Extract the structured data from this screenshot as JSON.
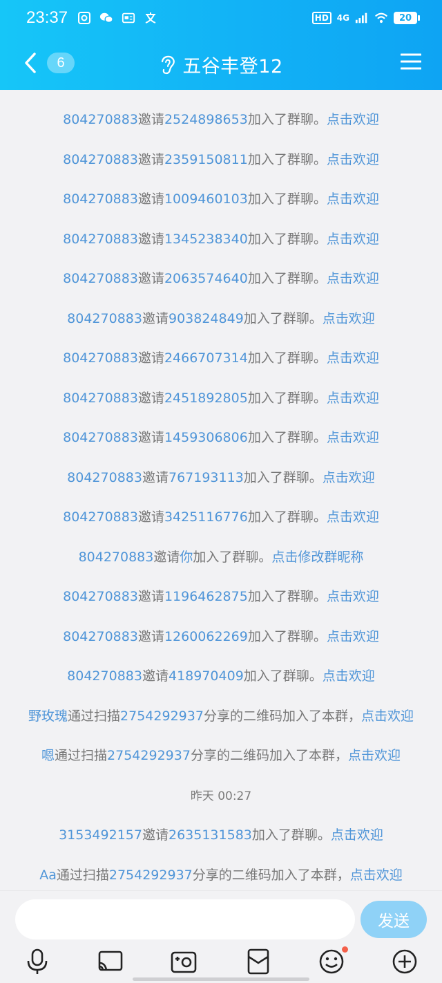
{
  "status_bar": {
    "time": "23:37",
    "hd": "HD",
    "network": "4G",
    "battery": "20"
  },
  "nav": {
    "unread_count": "6",
    "title": "五谷丰登12"
  },
  "messages": [
    {
      "user": "804270883",
      "verb": "邀请",
      "target": "2524898653",
      "tail": "加入了群聊。",
      "link": "点击欢迎"
    },
    {
      "user": "804270883",
      "verb": "邀请",
      "target": "2359150811",
      "tail": "加入了群聊。",
      "link": "点击欢迎"
    },
    {
      "user": "804270883",
      "verb": "邀请",
      "target": "1009460103",
      "tail": "加入了群聊。",
      "link": "点击欢迎"
    },
    {
      "user": "804270883",
      "verb": "邀请",
      "target": "1345238340",
      "tail": "加入了群聊。",
      "link": "点击欢迎"
    },
    {
      "user": "804270883",
      "verb": "邀请",
      "target": "2063574640",
      "tail": "加入了群聊。",
      "link": "点击欢迎"
    },
    {
      "user": "804270883",
      "verb": "邀请",
      "target": "903824849",
      "tail": "加入了群聊。",
      "link": "点击欢迎"
    },
    {
      "user": "804270883",
      "verb": "邀请",
      "target": "2466707314",
      "tail": "加入了群聊。",
      "link": "点击欢迎"
    },
    {
      "user": "804270883",
      "verb": "邀请",
      "target": "2451892805",
      "tail": "加入了群聊。",
      "link": "点击欢迎"
    },
    {
      "user": "804270883",
      "verb": "邀请",
      "target": "1459306806",
      "tail": "加入了群聊。",
      "link": "点击欢迎"
    },
    {
      "user": "804270883",
      "verb": "邀请",
      "target": "767193113",
      "tail": "加入了群聊。",
      "link": "点击欢迎"
    },
    {
      "user": "804270883",
      "verb": "邀请",
      "target": "3425116776",
      "tail": "加入了群聊。",
      "link": "点击欢迎"
    },
    {
      "user": "804270883",
      "verb": "邀请",
      "target": "你",
      "tail": "加入了群聊。",
      "link": "点击修改群昵称"
    },
    {
      "user": "804270883",
      "verb": "邀请",
      "target": "1196462875",
      "tail": "加入了群聊。",
      "link": "点击欢迎"
    },
    {
      "user": "804270883",
      "verb": "邀请",
      "target": "1260062269",
      "tail": "加入了群聊。",
      "link": "点击欢迎"
    },
    {
      "user": "804270883",
      "verb": "邀请",
      "target": "418970409",
      "tail": "加入了群聊。",
      "link": "点击欢迎"
    },
    {
      "user": "野玫瑰",
      "verb": "通过扫描",
      "target": "2754292937",
      "tail": "分享的二维码加入了本群，",
      "link": "点击欢迎"
    },
    {
      "user": "嗯",
      "verb": "通过扫描",
      "target": "2754292937",
      "tail": "分享的二维码加入了本群，",
      "link": "点击欢迎"
    },
    {
      "timestamp": "昨天 00:27"
    },
    {
      "user": "3153492157",
      "verb": "邀请",
      "target": "2635131583",
      "tail": "加入了群聊。",
      "link": "点击欢迎"
    },
    {
      "user": "Aa",
      "verb": "通过扫描",
      "target": "2754292937",
      "tail": "分享的二维码加入了本群，",
      "link": "点击欢迎"
    }
  ],
  "input": {
    "value": "",
    "send_label": "发送"
  },
  "toolbar": {
    "icons": [
      "microphone-icon",
      "screen-share-icon",
      "photo-icon",
      "red-packet-icon",
      "emoji-icon",
      "plus-icon"
    ]
  }
}
